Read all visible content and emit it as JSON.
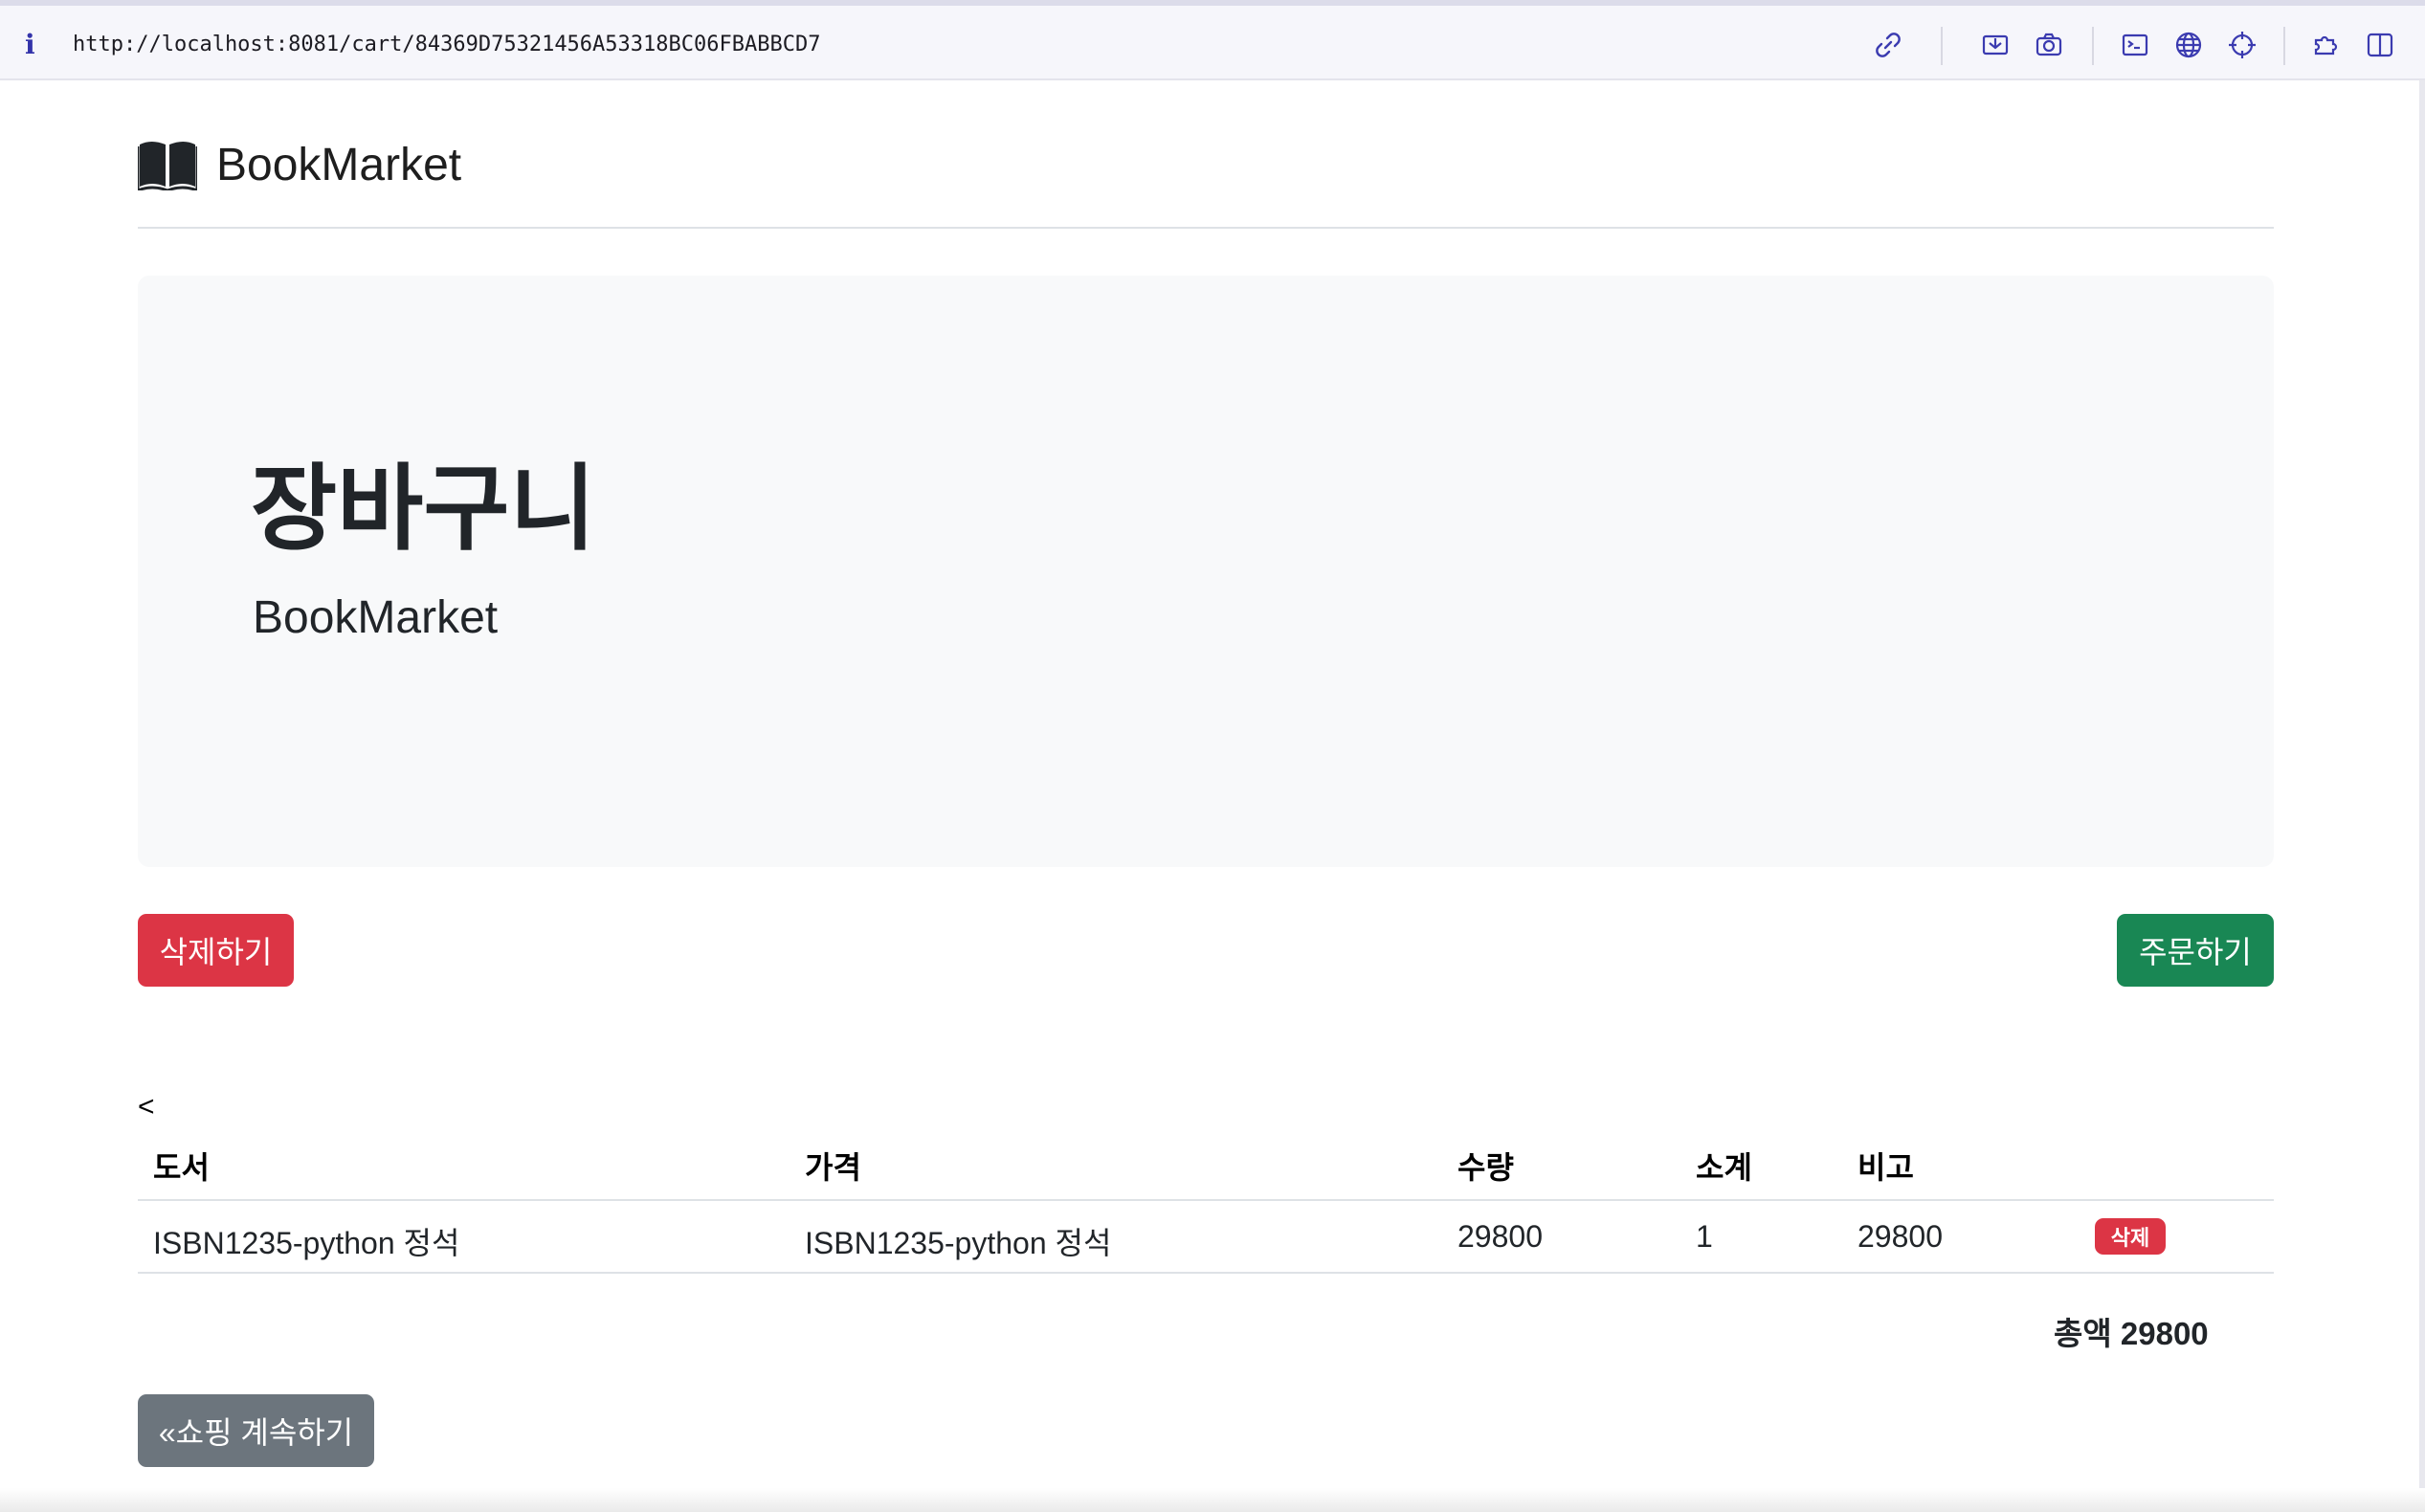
{
  "browser": {
    "info_glyph": "i",
    "url": "http://localhost:8081/cart/84369D75321456A53318BC06FBABBCD7",
    "toolbar_icons": [
      "link-icon",
      "screenshot-icon",
      "camera-icon",
      "terminal-icon",
      "globe-icon",
      "crosshair-icon",
      "extensions-icon",
      "sidebar-icon"
    ]
  },
  "brand": {
    "name": "BookMarket",
    "icon": "book-icon"
  },
  "jumbotron": {
    "title": "장바구니",
    "subtitle": "BookMarket"
  },
  "actions": {
    "delete_label": "삭제하기",
    "order_label": "주문하기",
    "continue_label": "«쇼핑 계속하기"
  },
  "stray_text": "<",
  "table": {
    "headers": [
      "도서",
      "가격",
      "수량",
      "소계",
      "비고"
    ],
    "rows": [
      {
        "book": "ISBN1235-python 정석",
        "price": "ISBN1235-python 정석",
        "quantity": "29800",
        "subtotal": "1",
        "note": "29800",
        "action": "삭제"
      }
    ]
  },
  "total": "총액 29800",
  "colors": {
    "danger": "#dc3545",
    "success": "#198754",
    "secondary": "#6c757d",
    "jumbotron_bg": "#f8f9fa"
  }
}
